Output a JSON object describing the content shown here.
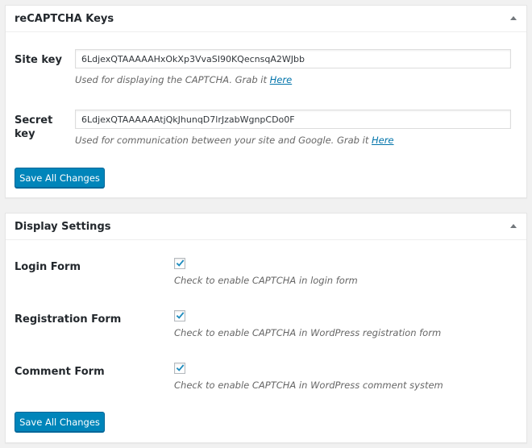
{
  "recaptcha_keys": {
    "title": "reCAPTCHA Keys",
    "site_key": {
      "label": "Site key",
      "value": "6LdjexQTAAAAAHxOkXp3VvaSI90KQecnsqA2WJbb",
      "description": "Used for displaying the CAPTCHA. Grab it",
      "link_text": "Here"
    },
    "secret_key": {
      "label_line1": "Secret",
      "label_line2": "key",
      "value": "6LdjexQTAAAAAAtjQkJhunqD7lrJzabWgnpCDo0F",
      "description": "Used for communication between your site and Google. Grab it",
      "link_text": "Here"
    },
    "save_label": "Save All Changes"
  },
  "display_settings": {
    "title": "Display Settings",
    "rows": [
      {
        "label": "Login Form",
        "checked": true,
        "description": "Check to enable CAPTCHA in login form"
      },
      {
        "label": "Registration Form",
        "checked": true,
        "description": "Check to enable CAPTCHA in WordPress registration form"
      },
      {
        "label": "Comment Form",
        "checked": true,
        "description": "Check to enable CAPTCHA in WordPress comment system"
      }
    ],
    "save_label": "Save All Changes"
  },
  "colors": {
    "primary_button": "#0085ba",
    "link": "#0073aa",
    "checkmark": "#1e8cbe"
  },
  "icons": {
    "collapse": "triangle-up-icon",
    "check": "checkmark-icon"
  }
}
